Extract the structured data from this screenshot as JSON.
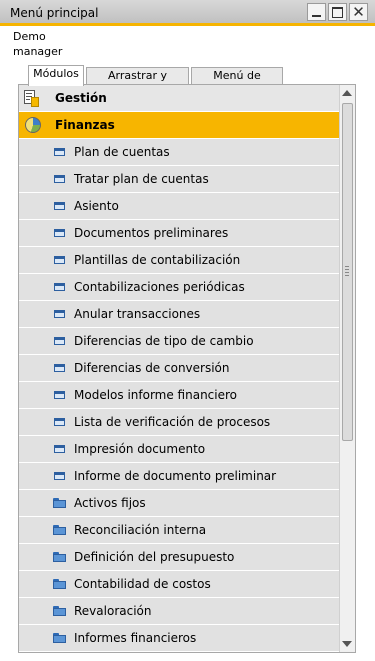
{
  "window": {
    "title": "Menú principal",
    "accent_color": "#f6b400",
    "controls": {
      "minimize_icon": "minimize-icon",
      "maximize_icon": "maximize-icon",
      "close_glyph": "✕"
    }
  },
  "user": {
    "line1": "Demo",
    "line2": "manager"
  },
  "tabs": [
    {
      "label": "Módulos",
      "active": true
    },
    {
      "label": "Arrastrar y vincular",
      "active": false
    },
    {
      "label": "Menú de usuario",
      "active": false
    }
  ],
  "menu": {
    "modules": [
      {
        "label": "Gestión",
        "icon": "management-icon",
        "selected": false
      },
      {
        "label": "Finanzas",
        "icon": "finance-pie-icon",
        "selected": true,
        "highlight_color": "#f7b500"
      }
    ],
    "items": [
      {
        "label": "Plan de cuentas",
        "icon": "window-icon"
      },
      {
        "label": "Tratar plan de cuentas",
        "icon": "window-icon"
      },
      {
        "label": "Asiento",
        "icon": "window-icon"
      },
      {
        "label": "Documentos preliminares",
        "icon": "window-icon"
      },
      {
        "label": "Plantillas de contabilización",
        "icon": "window-icon"
      },
      {
        "label": "Contabilizaciones periódicas",
        "icon": "window-icon"
      },
      {
        "label": "Anular transacciones",
        "icon": "window-icon"
      },
      {
        "label": "Diferencias de tipo de cambio",
        "icon": "window-icon"
      },
      {
        "label": "Diferencias de conversión",
        "icon": "window-icon"
      },
      {
        "label": "Modelos informe financiero",
        "icon": "window-icon"
      },
      {
        "label": "Lista de verificación de procesos",
        "icon": "window-icon"
      },
      {
        "label": "Impresión documento",
        "icon": "window-icon"
      },
      {
        "label": "Informe de documento preliminar",
        "icon": "window-icon"
      },
      {
        "label": "Activos fijos",
        "icon": "folder-icon"
      },
      {
        "label": "Reconciliación interna",
        "icon": "folder-icon"
      },
      {
        "label": "Definición del presupuesto",
        "icon": "folder-icon"
      },
      {
        "label": "Contabilidad de costos",
        "icon": "folder-icon"
      },
      {
        "label": "Revaloración",
        "icon": "folder-icon"
      },
      {
        "label": "Informes financieros",
        "icon": "folder-icon"
      }
    ]
  }
}
